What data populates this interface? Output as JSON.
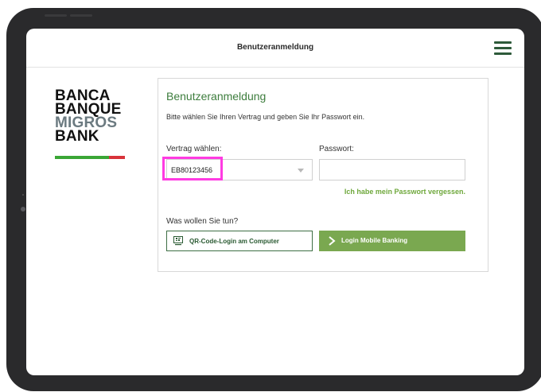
{
  "header": {
    "title": "Benutzeranmeldung"
  },
  "logo": {
    "line1": "BANCA",
    "line2": "BANQUE",
    "line3": "MIGROS",
    "line4": "BANK"
  },
  "login": {
    "title": "Benutzeranmeldung",
    "description": "Bitte wählen Sie Ihren Vertrag und geben Sie Ihr Passwort ein.",
    "contract_label": "Vertrag wählen:",
    "contract_value": "EB80123456",
    "password_label": "Passwort:",
    "password_value": "",
    "forgot_password": "Ich habe mein Passwort vergessen.",
    "action_question": "Was wollen Sie tun?",
    "qr_button_label": "QR-Code-Login am Computer",
    "mobile_button_label": "Login Mobile Banking"
  },
  "colors": {
    "brand_green": "#3d7d3d",
    "button_green": "#7aa850",
    "link_green": "#6fa83c",
    "highlight": "#ff3be2",
    "logo_green": "#3aa635",
    "logo_red": "#d8333a"
  }
}
